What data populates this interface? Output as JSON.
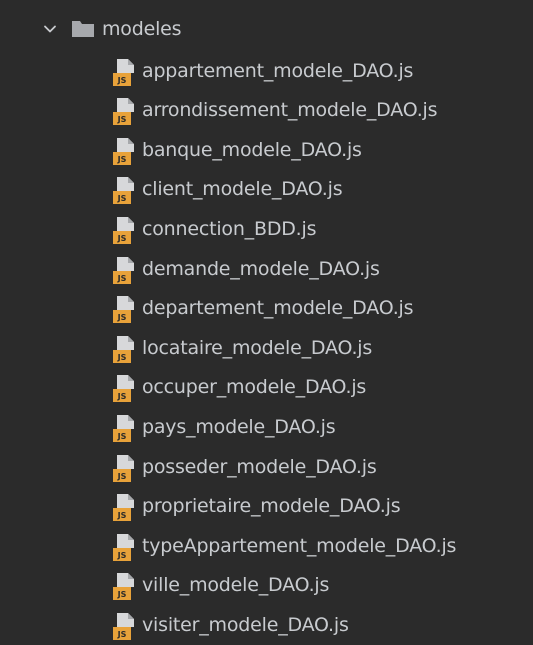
{
  "tree": {
    "folder": {
      "name": "modeles",
      "expanded": true,
      "icon": "folder-icon",
      "chevron": "chevron-down-icon"
    },
    "file_icon": "js-file-icon",
    "icon_badge": "JS",
    "files": [
      "appartement_modele_DAO.js",
      "arrondissement_modele_DAO.js",
      "banque_modele_DAO.js",
      "client_modele_DAO.js",
      "connection_BDD.js",
      "demande_modele_DAO.js",
      "departement_modele_DAO.js",
      "locataire_modele_DAO.js",
      "occuper_modele_DAO.js",
      "pays_modele_DAO.js",
      "posseder_modele_DAO.js",
      "proprietaire_modele_DAO.js",
      "typeAppartement_modele_DAO.js",
      "ville_modele_DAO.js",
      "visiter_modele_DAO.js"
    ]
  },
  "colors": {
    "background": "#2b2b2b",
    "text": "#c8cbcf",
    "folder": "#a7a9ad",
    "js_badge": "#e8a23a"
  }
}
